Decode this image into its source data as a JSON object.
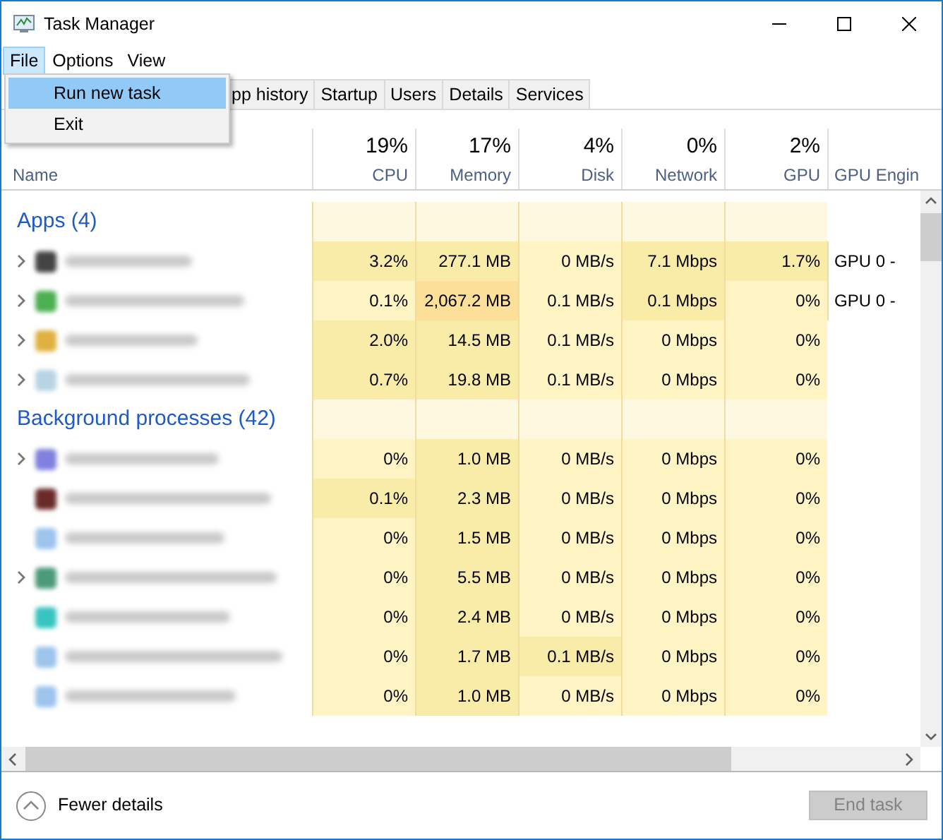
{
  "window": {
    "title": "Task Manager"
  },
  "menu_bar": [
    {
      "label": "File",
      "selected": true
    },
    {
      "label": "Options",
      "selected": false
    },
    {
      "label": "View",
      "selected": false
    }
  ],
  "file_menu": [
    {
      "label": "Run new task",
      "selected": true
    },
    {
      "label": "Exit",
      "selected": false
    }
  ],
  "tabs": [
    {
      "label": "pp history",
      "selected": false
    },
    {
      "label": "Startup",
      "selected": false
    },
    {
      "label": "Users",
      "selected": false
    },
    {
      "label": "Details",
      "selected": false
    },
    {
      "label": "Services",
      "selected": false
    }
  ],
  "columns": [
    {
      "label": "Name"
    },
    {
      "percent": "19%",
      "label": "CPU"
    },
    {
      "percent": "17%",
      "label": "Memory"
    },
    {
      "percent": "4%",
      "label": "Disk"
    },
    {
      "percent": "0%",
      "label": "Network"
    },
    {
      "percent": "2%",
      "label": "GPU"
    },
    {
      "label": "GPU Engin"
    }
  ],
  "groups": [
    {
      "title": "Apps (4)",
      "rows": [
        {
          "expandable": true,
          "color": "#444444",
          "cells": [
            {
              "text": "3.2%",
              "color": "#f9eca8"
            },
            {
              "text": "277.1 MB",
              "color": "#f9eca8"
            },
            {
              "text": "0 MB/s",
              "color": "#fff4c4"
            },
            {
              "text": "7.1 Mbps",
              "color": "#f9eca8"
            },
            {
              "text": "1.7%",
              "color": "#f9eca8"
            }
          ],
          "engine": "GPU 0 -"
        },
        {
          "expandable": true,
          "color": "#4caf50",
          "cells": [
            {
              "text": "0.1%",
              "color": "#fff4c4"
            },
            {
              "text": "2,067.2 MB",
              "color": "#fcdf98"
            },
            {
              "text": "0.1 MB/s",
              "color": "#fff4c4"
            },
            {
              "text": "0.1 Mbps",
              "color": "#f9eca8"
            },
            {
              "text": "0%",
              "color": "#fff4c4"
            }
          ],
          "engine": "GPU 0 -"
        },
        {
          "expandable": true,
          "color": "#e0b040",
          "cells": [
            {
              "text": "2.0%",
              "color": "#f9eca8"
            },
            {
              "text": "14.5 MB",
              "color": "#f9eca8"
            },
            {
              "text": "0.1 MB/s",
              "color": "#fff4c4"
            },
            {
              "text": "0 Mbps",
              "color": "#fff4c4"
            },
            {
              "text": "0%",
              "color": "#fff4c4"
            }
          ]
        },
        {
          "expandable": true,
          "color": "#b8d4e4",
          "cells": [
            {
              "text": "0.7%",
              "color": "#f9eca8"
            },
            {
              "text": "19.8 MB",
              "color": "#f9eca8"
            },
            {
              "text": "0.1 MB/s",
              "color": "#fff4c4"
            },
            {
              "text": "0 Mbps",
              "color": "#fff4c4"
            },
            {
              "text": "0%",
              "color": "#fff4c4"
            }
          ]
        }
      ]
    },
    {
      "title": "Background processes (42)",
      "rows": [
        {
          "expandable": true,
          "color": "#8080e0",
          "cells": [
            {
              "text": "0%",
              "color": "#fff4c4"
            },
            {
              "text": "1.0 MB",
              "color": "#f9eca8"
            },
            {
              "text": "0 MB/s",
              "color": "#fff4c4"
            },
            {
              "text": "0 Mbps",
              "color": "#fff4c4"
            },
            {
              "text": "0%",
              "color": "#fff4c4"
            }
          ]
        },
        {
          "expandable": false,
          "color": "#6a2a2a",
          "cells": [
            {
              "text": "0.1%",
              "color": "#f9eca8"
            },
            {
              "text": "2.3 MB",
              "color": "#f9eca8"
            },
            {
              "text": "0 MB/s",
              "color": "#fff4c4"
            },
            {
              "text": "0 Mbps",
              "color": "#fff4c4"
            },
            {
              "text": "0%",
              "color": "#fff4c4"
            }
          ]
        },
        {
          "expandable": false,
          "color": "#9cc4ec",
          "cells": [
            {
              "text": "0%",
              "color": "#fff4c4"
            },
            {
              "text": "1.5 MB",
              "color": "#f9eca8"
            },
            {
              "text": "0 MB/s",
              "color": "#fff4c4"
            },
            {
              "text": "0 Mbps",
              "color": "#fff4c4"
            },
            {
              "text": "0%",
              "color": "#fff4c4"
            }
          ]
        },
        {
          "expandable": true,
          "color": "#4c9a7a",
          "cells": [
            {
              "text": "0%",
              "color": "#fff4c4"
            },
            {
              "text": "5.5 MB",
              "color": "#f9eca8"
            },
            {
              "text": "0 MB/s",
              "color": "#fff4c4"
            },
            {
              "text": "0 Mbps",
              "color": "#fff4c4"
            },
            {
              "text": "0%",
              "color": "#fff4c4"
            }
          ]
        },
        {
          "expandable": false,
          "color": "#38c4c0",
          "cells": [
            {
              "text": "0%",
              "color": "#fff4c4"
            },
            {
              "text": "2.4 MB",
              "color": "#f9eca8"
            },
            {
              "text": "0 MB/s",
              "color": "#fff4c4"
            },
            {
              "text": "0 Mbps",
              "color": "#fff4c4"
            },
            {
              "text": "0%",
              "color": "#fff4c4"
            }
          ]
        },
        {
          "expandable": false,
          "color": "#9cc4ec",
          "cells": [
            {
              "text": "0%",
              "color": "#fff4c4"
            },
            {
              "text": "1.7 MB",
              "color": "#f9eca8"
            },
            {
              "text": "0.1 MB/s",
              "color": "#f9eca8"
            },
            {
              "text": "0 Mbps",
              "color": "#fff4c4"
            },
            {
              "text": "0%",
              "color": "#fff4c4"
            }
          ]
        },
        {
          "expandable": false,
          "color": "#9cc4ec",
          "cells": [
            {
              "text": "0%",
              "color": "#fff4c4"
            },
            {
              "text": "1.0 MB",
              "color": "#f9eca8"
            },
            {
              "text": "0 MB/s",
              "color": "#fff4c4"
            },
            {
              "text": "0 Mbps",
              "color": "#fff4c4"
            },
            {
              "text": "0%",
              "color": "#fff4c4"
            }
          ]
        }
      ]
    }
  ],
  "footer": {
    "details_label": "Fewer details",
    "end_task": {
      "label": "End task",
      "disabled": true
    }
  }
}
